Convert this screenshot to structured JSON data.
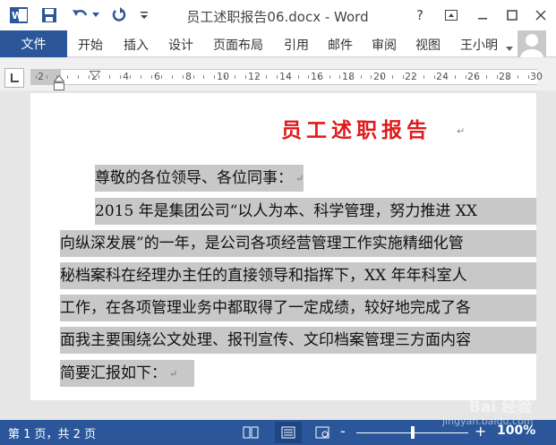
{
  "titlebar": {
    "title": "员工述职报告06.docx - Word",
    "help": "?"
  },
  "ribbon": {
    "file_tab": "文件",
    "tabs": [
      "开始",
      "插入",
      "设计",
      "页面布局",
      "引用",
      "邮件",
      "审阅",
      "视图"
    ],
    "user": "王小明"
  },
  "ruler": {
    "labels": [
      "2",
      "2",
      "4",
      "6",
      "8",
      "10",
      "12",
      "14",
      "16",
      "18",
      "20",
      "22",
      "24",
      "26",
      "28",
      "30"
    ]
  },
  "document": {
    "heading": "员工述职报告",
    "lines": [
      "尊敬的各位领导、各位同事：",
      "2015 年是集团公司“以人为本、科学管理，努力推进 XX",
      "向纵深发展”的一年，是公司各项经营管理工作实施精细化管",
      "秘档案科在经理办主任的直接领导和指挥下，XX 年年科室人",
      "工作，在各项管理业务中都取得了一定成绩，较好地完成了各",
      "面我主要围绕公文处理、报刊宣传、文印档案管理三方面内容",
      "简要汇报如下："
    ],
    "paragraph_mark": "↵"
  },
  "statusbar": {
    "page_count": "第 1 页，共 2 页",
    "zoom_level": "100%",
    "zoom_out": "-",
    "zoom_in": "+"
  },
  "watermark": {
    "main": "Bai 经验",
    "url": "jingyan.baidu.com"
  },
  "colors": {
    "brand": "#2b579a",
    "heading": "#e01a1a",
    "selection": "#c8c8c8"
  }
}
